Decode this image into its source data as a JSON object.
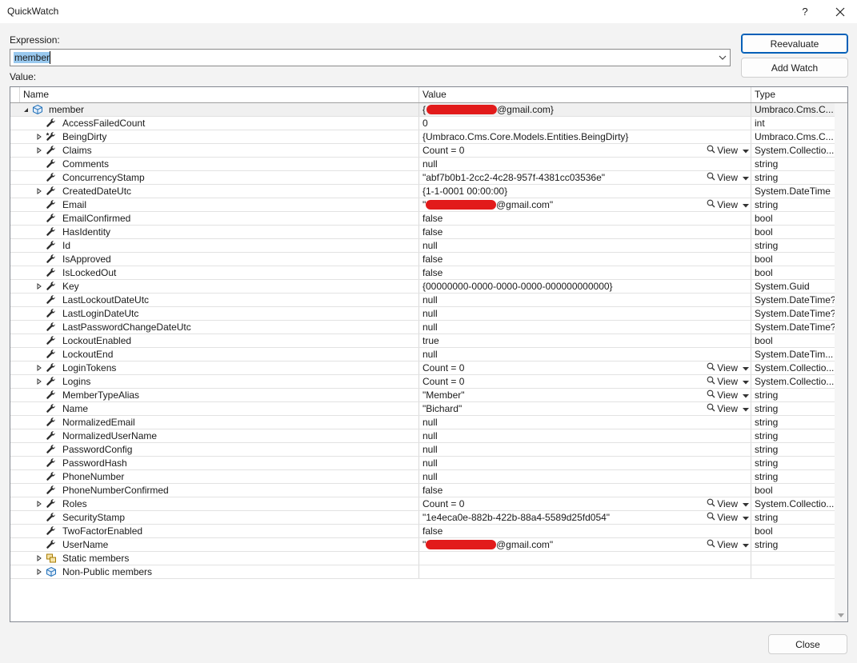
{
  "window": {
    "title": "QuickWatch",
    "help_label": "?"
  },
  "expression": {
    "label": "Expression:",
    "value": "member"
  },
  "value_label": "Value:",
  "buttons": {
    "reevaluate": "Reevaluate",
    "add_watch": "Add Watch",
    "close": "Close"
  },
  "grid": {
    "columns": {
      "name": "Name",
      "value": "Value",
      "type": "Type"
    },
    "view_label": "View",
    "rows": [
      {
        "name": "member",
        "value": "{",
        "suffix": "@gmail.com}",
        "type": "Umbraco.Cms.C...",
        "level": 0,
        "expander": "open",
        "icon": "object-icon",
        "view": false,
        "redact": true
      },
      {
        "name": "AccessFailedCount",
        "value": "0",
        "type": "int",
        "level": 1,
        "expander": "none",
        "icon": "wrench-icon",
        "view": false
      },
      {
        "name": "BeingDirty",
        "value": "{Umbraco.Cms.Core.Models.Entities.BeingDirty}",
        "type": "Umbraco.Cms.C...",
        "level": 1,
        "expander": "closed",
        "icon": "private-field-icon",
        "view": false
      },
      {
        "name": "Claims",
        "value": "Count = 0",
        "type": "System.Collectio...",
        "level": 1,
        "expander": "closed",
        "icon": "wrench-icon",
        "view": true
      },
      {
        "name": "Comments",
        "value": "null",
        "type": "string",
        "level": 1,
        "expander": "none",
        "icon": "wrench-icon",
        "view": false
      },
      {
        "name": "ConcurrencyStamp",
        "value": "\"abf7b0b1-2cc2-4c28-957f-4381cc03536e\"",
        "type": "string",
        "level": 1,
        "expander": "none",
        "icon": "wrench-icon",
        "view": true
      },
      {
        "name": "CreatedDateUtc",
        "value": "{1-1-0001 00:00:00}",
        "type": "System.DateTime",
        "level": 1,
        "expander": "closed",
        "icon": "wrench-icon",
        "view": false
      },
      {
        "name": "Email",
        "value": "\"",
        "suffix": "@gmail.com\"",
        "type": "string",
        "level": 1,
        "expander": "none",
        "icon": "wrench-icon",
        "view": true,
        "redact": true
      },
      {
        "name": "EmailConfirmed",
        "value": "false",
        "type": "bool",
        "level": 1,
        "expander": "none",
        "icon": "wrench-icon",
        "view": false
      },
      {
        "name": "HasIdentity",
        "value": "false",
        "type": "bool",
        "level": 1,
        "expander": "none",
        "icon": "wrench-icon",
        "view": false
      },
      {
        "name": "Id",
        "value": "null",
        "type": "string",
        "level": 1,
        "expander": "none",
        "icon": "wrench-icon",
        "view": false
      },
      {
        "name": "IsApproved",
        "value": "false",
        "type": "bool",
        "level": 1,
        "expander": "none",
        "icon": "wrench-icon",
        "view": false
      },
      {
        "name": "IsLockedOut",
        "value": "false",
        "type": "bool",
        "level": 1,
        "expander": "none",
        "icon": "wrench-icon",
        "view": false
      },
      {
        "name": "Key",
        "value": "{00000000-0000-0000-0000-000000000000}",
        "type": "System.Guid",
        "level": 1,
        "expander": "closed",
        "icon": "wrench-icon",
        "view": false
      },
      {
        "name": "LastLockoutDateUtc",
        "value": "null",
        "type": "System.DateTime?",
        "level": 1,
        "expander": "none",
        "icon": "wrench-icon",
        "view": false
      },
      {
        "name": "LastLoginDateUtc",
        "value": "null",
        "type": "System.DateTime?",
        "level": 1,
        "expander": "none",
        "icon": "wrench-icon",
        "view": false
      },
      {
        "name": "LastPasswordChangeDateUtc",
        "value": "null",
        "type": "System.DateTime?",
        "level": 1,
        "expander": "none",
        "icon": "wrench-icon",
        "view": false
      },
      {
        "name": "LockoutEnabled",
        "value": "true",
        "type": "bool",
        "level": 1,
        "expander": "none",
        "icon": "wrench-icon",
        "view": false
      },
      {
        "name": "LockoutEnd",
        "value": "null",
        "type": "System.DateTim...",
        "level": 1,
        "expander": "none",
        "icon": "wrench-icon",
        "view": false
      },
      {
        "name": "LoginTokens",
        "value": "Count = 0",
        "type": "System.Collectio...",
        "level": 1,
        "expander": "closed",
        "icon": "wrench-icon",
        "view": true
      },
      {
        "name": "Logins",
        "value": "Count = 0",
        "type": "System.Collectio...",
        "level": 1,
        "expander": "closed",
        "icon": "wrench-icon",
        "view": true
      },
      {
        "name": "MemberTypeAlias",
        "value": "\"Member\"",
        "type": "string",
        "level": 1,
        "expander": "none",
        "icon": "wrench-icon",
        "view": true
      },
      {
        "name": "Name",
        "value": "\"Bichard\"",
        "type": "string",
        "level": 1,
        "expander": "none",
        "icon": "wrench-icon",
        "view": true
      },
      {
        "name": "NormalizedEmail",
        "value": "null",
        "type": "string",
        "level": 1,
        "expander": "none",
        "icon": "wrench-icon",
        "view": false
      },
      {
        "name": "NormalizedUserName",
        "value": "null",
        "type": "string",
        "level": 1,
        "expander": "none",
        "icon": "wrench-icon",
        "view": false
      },
      {
        "name": "PasswordConfig",
        "value": "null",
        "type": "string",
        "level": 1,
        "expander": "none",
        "icon": "wrench-icon",
        "view": false
      },
      {
        "name": "PasswordHash",
        "value": "null",
        "type": "string",
        "level": 1,
        "expander": "none",
        "icon": "wrench-icon",
        "view": false
      },
      {
        "name": "PhoneNumber",
        "value": "null",
        "type": "string",
        "level": 1,
        "expander": "none",
        "icon": "wrench-icon",
        "view": false
      },
      {
        "name": "PhoneNumberConfirmed",
        "value": "false",
        "type": "bool",
        "level": 1,
        "expander": "none",
        "icon": "wrench-icon",
        "view": false
      },
      {
        "name": "Roles",
        "value": "Count = 0",
        "type": "System.Collectio...",
        "level": 1,
        "expander": "closed",
        "icon": "wrench-icon",
        "view": true
      },
      {
        "name": "SecurityStamp",
        "value": "\"1e4eca0e-882b-422b-88a4-5589d25fd054\"",
        "type": "string",
        "level": 1,
        "expander": "none",
        "icon": "wrench-icon",
        "view": true
      },
      {
        "name": "TwoFactorEnabled",
        "value": "false",
        "type": "bool",
        "level": 1,
        "expander": "none",
        "icon": "wrench-icon",
        "view": false
      },
      {
        "name": "UserName",
        "value": "\"",
        "suffix": "@gmail.com\"",
        "type": "string",
        "level": 1,
        "expander": "none",
        "icon": "wrench-icon",
        "view": true,
        "redact": true
      },
      {
        "name": "Static members",
        "value": "",
        "type": "",
        "level": 1,
        "expander": "closed",
        "icon": "static-members-icon",
        "view": false
      },
      {
        "name": "Non-Public members",
        "value": "",
        "type": "",
        "level": 1,
        "expander": "closed",
        "icon": "object-icon",
        "view": false
      }
    ]
  }
}
